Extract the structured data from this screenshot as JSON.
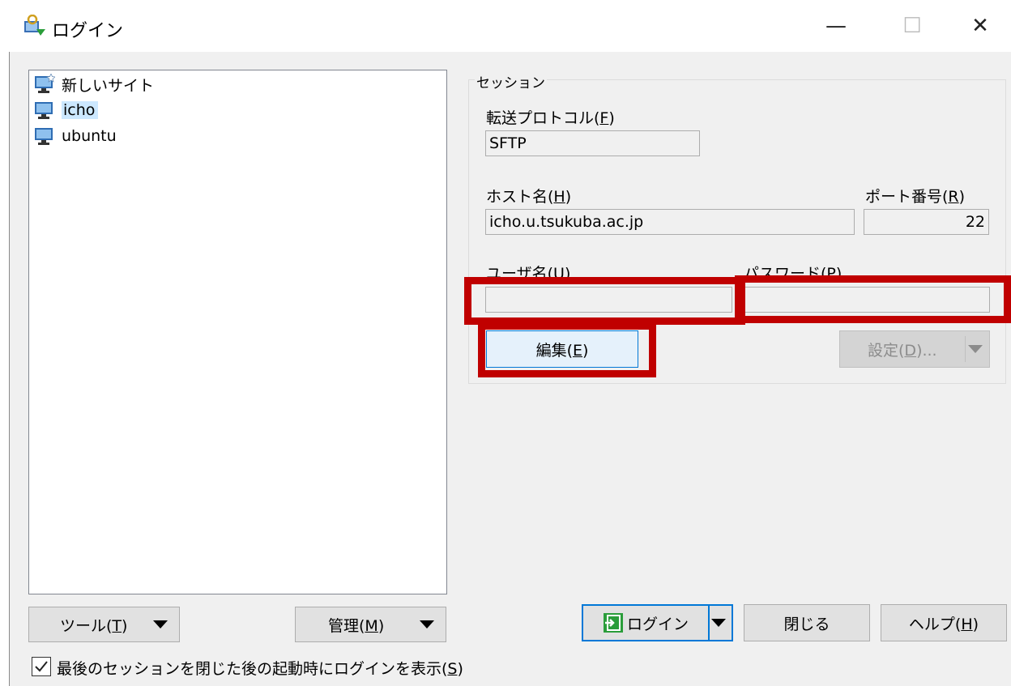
{
  "window": {
    "title": "ログイン",
    "minimize_glyph": "—",
    "maximize_glyph": "☐",
    "close_glyph": "✕"
  },
  "sites": [
    {
      "label": "新しいサイト",
      "icon": "new-site-monitor-icon"
    },
    {
      "label": "icho",
      "icon": "monitor-icon"
    },
    {
      "label": "ubuntu",
      "icon": "monitor-icon"
    }
  ],
  "left_buttons": {
    "tools": {
      "label": "ツール(",
      "key": "T",
      "end": ")"
    },
    "manage": {
      "label": "管理(",
      "key": "M",
      "end": ")"
    }
  },
  "checkbox": {
    "label": "最後のセッションを閉じた後の起動時にログインを表示(",
    "key": "S",
    "end": ")",
    "checked": true
  },
  "session": {
    "caption": "セッション",
    "protocol": {
      "label": "転送プロトコル(",
      "key": "F",
      "end": ")",
      "value": "SFTP"
    },
    "host": {
      "label": "ホスト名(",
      "key": "H",
      "end": ")",
      "value": "icho.u.tsukuba.ac.jp"
    },
    "port": {
      "label": "ポート番号(",
      "key": "R",
      "end": ")",
      "value": "22"
    },
    "user": {
      "label": "ユーザ名(",
      "key": "U",
      "end": ")",
      "value": ""
    },
    "password": {
      "label": "パスワード(",
      "key": "P",
      "end": ")",
      "value": ""
    },
    "edit_button": {
      "label": "編集(",
      "key": "E",
      "end": ")"
    },
    "settings_button": {
      "label": "設定(",
      "key": "D",
      "end": ")..."
    }
  },
  "bottom_buttons": {
    "login": {
      "label": "ログイン"
    },
    "close": {
      "label": "閉じる"
    },
    "help": {
      "label": "ヘルプ(",
      "key": "H",
      "end": ")"
    }
  },
  "colors": {
    "highlight": "#c00000",
    "selected": "#cce8ff",
    "login_border": "#0078d7"
  }
}
